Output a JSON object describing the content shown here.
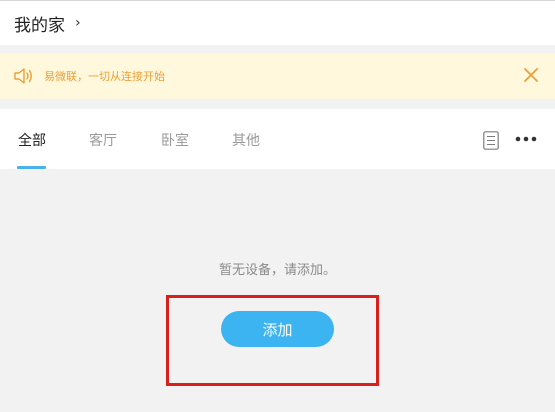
{
  "header": {
    "title": "我的家",
    "chevron": "›"
  },
  "notice": {
    "icon": "speaker-icon",
    "text": "易微联，一切从连接开始",
    "close_icon": "close-icon"
  },
  "tabs": [
    {
      "label": "全部",
      "active": true
    },
    {
      "label": "客厅",
      "active": false
    },
    {
      "label": "卧室",
      "active": false
    },
    {
      "label": "其他",
      "active": false
    }
  ],
  "toolbar": {
    "list_icon": "list-icon",
    "more_icon": "more-icon"
  },
  "empty_state": {
    "message": "暂无设备，请添加。",
    "add_label": "添加"
  },
  "colors": {
    "accent": "#3db4f2",
    "notice_bg": "#fff8dc",
    "notice_text": "#e8a13a",
    "highlight": "#d9201c"
  }
}
